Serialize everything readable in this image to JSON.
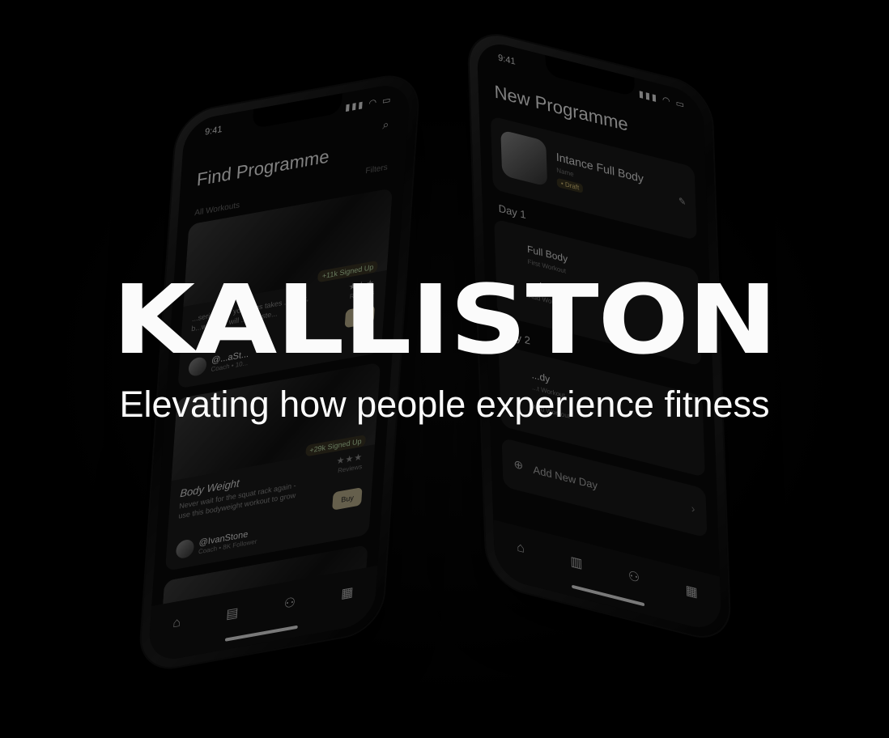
{
  "brand": {
    "title": "KALLISTON",
    "tagline": "Elevating how people experience fitness"
  },
  "phone_left": {
    "time": "9:41",
    "status_icons": "signal-icon wifi-icon battery-icon",
    "title": "Find Programme",
    "filters_label": "Filters",
    "section_label": "All Workouts",
    "cards": [
      {
        "name": "",
        "description": "...serious so your legs takes ...effort, b...workout will ...re faste...",
        "signed_up": "+11k Signed Up",
        "stars": "★★★",
        "reviews": "Reviews",
        "buy": "Buy",
        "coach_handle": "@...aSt...",
        "coach_meta": "Coach • 10..."
      },
      {
        "name": "Body Weight",
        "description": "Never wait for the squat rack again - use this bodyweight workout to grow",
        "signed_up": "+29k Signed Up",
        "stars": "★★★",
        "reviews": "Reviews",
        "buy": "Buy",
        "coach_handle": "@IvanStone",
        "coach_meta": "Coach • 8K Follower"
      }
    ],
    "tabs": [
      "home-icon",
      "store-icon",
      "people-icon",
      "clipboard-icon"
    ]
  },
  "phone_right": {
    "time": "9:41",
    "title": "New Programme",
    "programme_name": "Intance Full Body",
    "name_label": "Name",
    "draft": "• Draft",
    "days": [
      {
        "label": "Day 1",
        "workouts": [
          {
            "name": "Full Body",
            "sub": "First Workout"
          },
          {
            "name": "...dy",
            "sub": "Add Workout"
          }
        ]
      },
      {
        "label": "Day 2",
        "workouts": [
          {
            "name": "...dy",
            "sub": "...t Workout"
          },
          {
            "name": "",
            "sub": "Add Workout"
          }
        ]
      }
    ],
    "add_day": "Add New Day",
    "tabs": [
      "home-icon",
      "chart-icon",
      "people-icon",
      "clipboard-icon"
    ]
  },
  "colors": {
    "background": "#000000",
    "accent": "#b8ad8a",
    "text": "#fbfbfb"
  }
}
